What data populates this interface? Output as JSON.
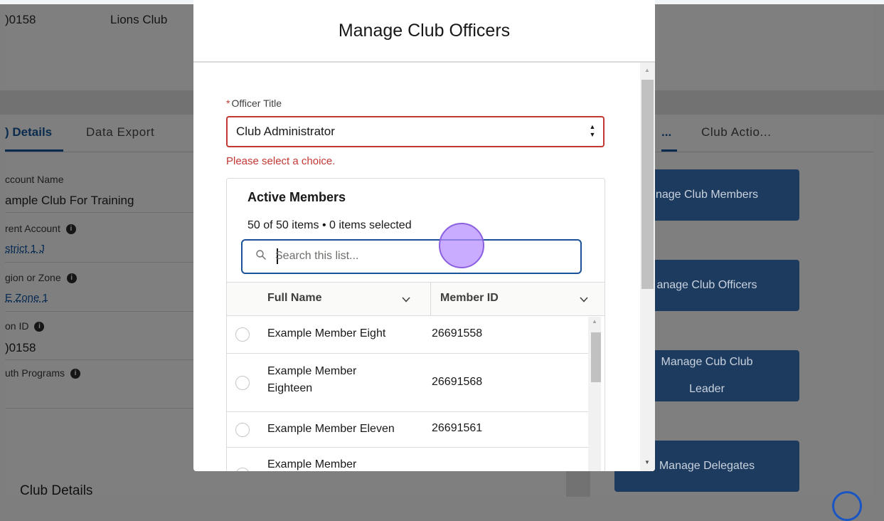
{
  "background": {
    "header": {
      "record_number": ")0158",
      "type_value": "Lions Club"
    },
    "tabs": {
      "active": ") Details",
      "second": "Data Export"
    },
    "fields": [
      {
        "label": "ccount Name",
        "value": "ample Club For Training"
      },
      {
        "label": "rent Account",
        "link": "strict 1 J"
      },
      {
        "label": "gion or Zone",
        "link": "E Zone 1"
      },
      {
        "label": "on ID",
        "value": ")0158"
      },
      {
        "label": "uth Programs"
      }
    ],
    "section_title": "Club Details",
    "right_tabs": {
      "active": "...",
      "second": "Club Actio..."
    },
    "actions": [
      {
        "line1": "nage Club Members"
      },
      {
        "line1": "anage Club Officers"
      },
      {
        "line1": "Manage Cub Club",
        "line2": "Leader"
      },
      {
        "line1": "Manage Delegates"
      }
    ]
  },
  "modal": {
    "title": "Manage Club Officers",
    "officer_title": {
      "required_marker": "*",
      "label": "Officer Title",
      "selected": "Club Administrator",
      "error": "Please select a choice."
    },
    "members": {
      "title": "Active Members",
      "count_text": "50 of 50 items • 0 items selected",
      "search_placeholder": "Search this list...",
      "columns": [
        "Full Name",
        "Member ID"
      ],
      "rows": [
        {
          "name": "Example Member Eight",
          "id": "26691558"
        },
        {
          "name": "Example Member Eighteen",
          "id": "26691568"
        },
        {
          "name": "Example Member Eleven",
          "id": "26691561"
        },
        {
          "name": "Example Member",
          "id": ""
        }
      ]
    }
  },
  "colors": {
    "accent": "#1b5297",
    "error": "#c23934",
    "button": "#1d3a5f"
  }
}
